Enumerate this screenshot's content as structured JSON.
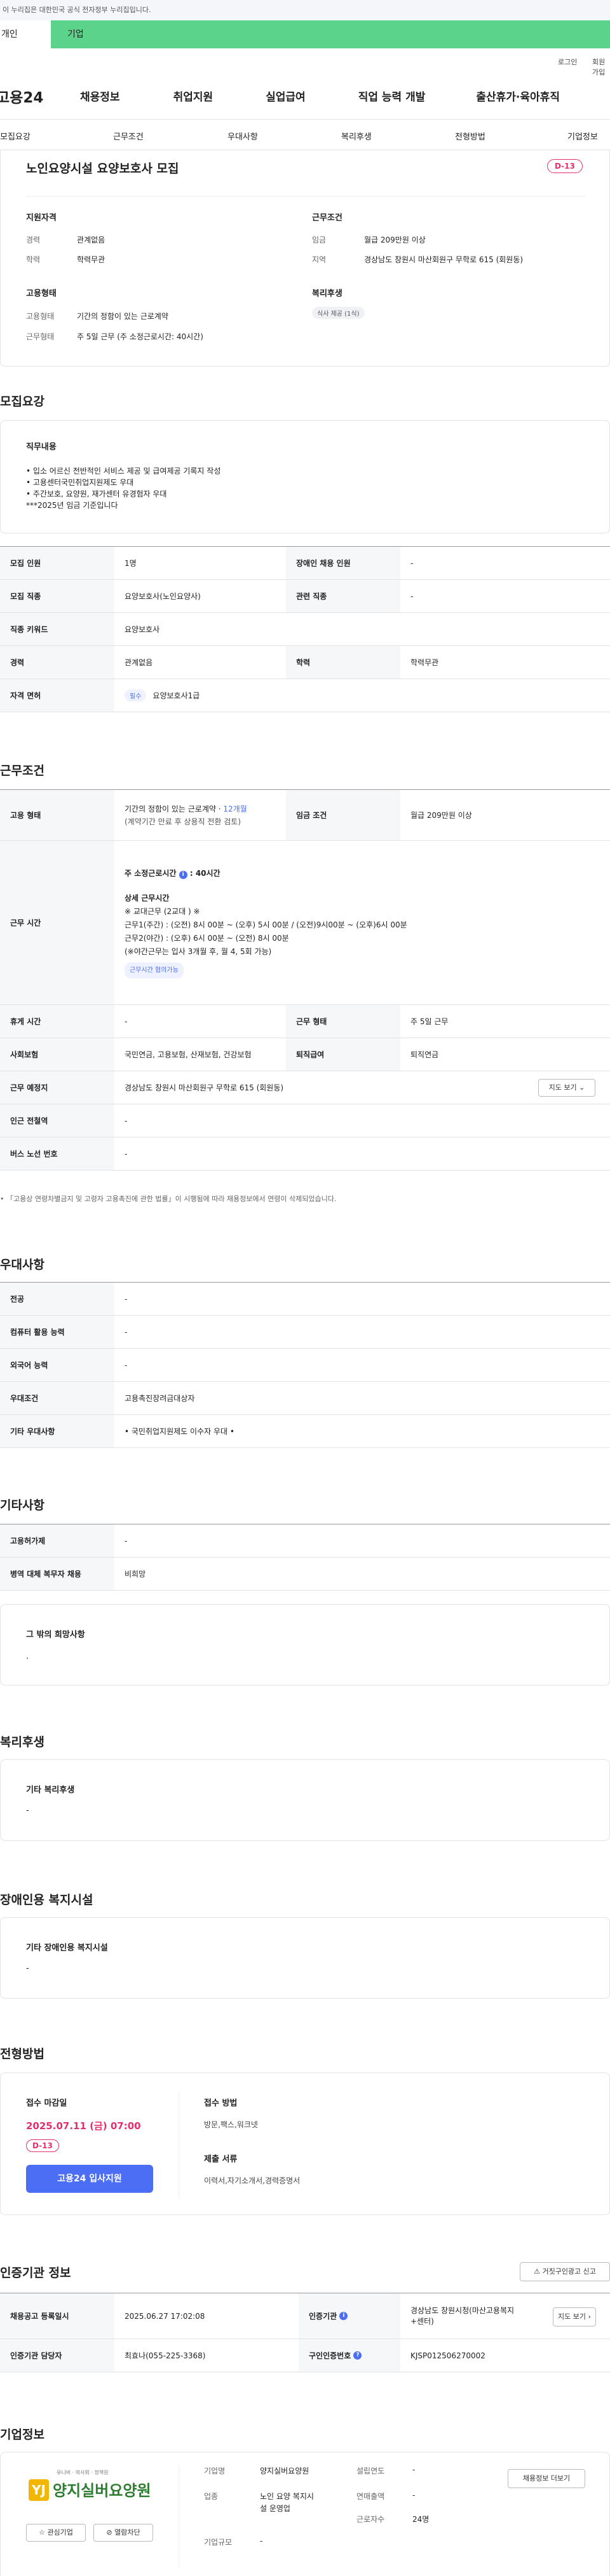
{
  "gov_notice": "이 누리집은 대한민국 공식 전자정부 누리집입니다.",
  "env_tabs": [
    "개인",
    "기업"
  ],
  "util": {
    "login": "로그인",
    "join": "회원가입"
  },
  "gnb": {
    "logo": "고용24",
    "menus": [
      "채용정보",
      "취업지원",
      "실업급여",
      "직업 능력 개발",
      "출산휴가·육아휴직"
    ]
  },
  "anchors": [
    "모집요강",
    "근무조건",
    "우대사항",
    "복리후생",
    "전형방법",
    "기업정보"
  ],
  "summary": {
    "title": "노인요양시설 요양보호사 모집",
    "dday": "D-13",
    "qual_title": "지원자격",
    "work_title": "근무조건",
    "career_label": "경력",
    "career": "관계없음",
    "edu_label": "학력",
    "edu": "학력무관",
    "wage_label": "임금",
    "wage": "월급 209만원 이상",
    "region_label": "지역",
    "region": "경상남도 창원시 마산회원구 무학로 615 (회원동)",
    "emp_title": "고용형태",
    "welfare_title": "복리후생",
    "emptype_label": "고용형태",
    "emptype": "기간의 정함이 있는 근로계약",
    "workform_label": "근무형태",
    "workform": "주 5일 근무 (주 소정근로시간: 40시간)",
    "welfare_badge": "식사 제공 (1식)"
  },
  "recruit": {
    "section": "모집요강",
    "duty_title": "직무내용",
    "duty_lines": [
      "• 입소 어르신 전반적인 서비스 제공 및 급여제공 기록지 작성",
      "• 고용센터국민취업지원제도 우대",
      "• 주간보호, 요양원, 재가센터 유경험자 우대",
      "***2025년 임금 기준입니다"
    ],
    "rows": [
      {
        "k1": "모집 인원",
        "v1": "1명",
        "k2": "장애인 채용 인원",
        "v2": "-"
      },
      {
        "k1": "모집 직종",
        "v1": "요양보호사(노인요양사)",
        "k2": "관련 직종",
        "v2": "-"
      },
      {
        "k1": "직종 키워드",
        "v1": "요양보호사"
      },
      {
        "k1": "경력",
        "v1": "관계없음",
        "k2": "학력",
        "v2": "학력무관"
      }
    ],
    "license_label": "자격 면허",
    "license_badge": "필수",
    "license": "요양보호사1급"
  },
  "cond": {
    "section": "근무조건",
    "emptype_label": "고용 형태",
    "emptype_line1": "기간의 정함이 있는 근로계약 ·",
    "emptype_months": "12개월",
    "emptype_line2": "(계약기간 만료 후 상용직 전환 검토)",
    "wage_label": "임금 조건",
    "wage": "월급 209만원 이상",
    "hours_label": "근무 시간",
    "hours_main": "주 소정근로시간",
    "hours_value": ": 40시간",
    "hours_detail_title": "상세 근무시간",
    "hours_lines": [
      "※ 교대근무 (2교대 ) ※",
      "근무1(주간) : (오전) 8시 00분 ~ (오후) 5시 00분 / (오전)9시00분 ~ (오후)6시 00분",
      "근무2(야간) : (오후) 6시 00분 ~ (오전) 8시 00분",
      "(※야간근무는 입사 3개월 후, 월 4, 5회 가능)"
    ],
    "hours_badge": "근무시간 협의가능",
    "rest_label": "휴게 시간",
    "rest": "-",
    "form_label": "근무 형태",
    "form": "주 5일 근무",
    "ins_label": "사회보험",
    "ins": "국민연금, 고용보험, 산재보험, 건강보험",
    "sev_label": "퇴직급여",
    "sev": "퇴직연금",
    "place_label": "근무 예정지",
    "place": "경상남도 창원시 마산회원구 무학로 615 (회원동)",
    "map_btn": "지도 보기",
    "subway_label": "인근 전철역",
    "subway": "-",
    "bus_label": "버스 노선 번호",
    "bus": "-",
    "footnote": "• 「고용상 연령차별금지 및 고령자 고용촉진에 관한 법률」이 시행됨에 따라 채용정보에서 연령이 삭제되었습니다."
  },
  "pref": {
    "section": "우대사항",
    "rows": [
      {
        "k": "전공",
        "v": "-"
      },
      {
        "k": "컴퓨터 활용 능력",
        "v": "-"
      },
      {
        "k": "외국어 능력",
        "v": "-"
      },
      {
        "k": "우대조건",
        "v": "고용촉진장려금대상자"
      },
      {
        "k": "기타 우대사항",
        "v": "• 국민취업지원제도 이수자 우대 •"
      }
    ]
  },
  "etc": {
    "section": "기타사항",
    "rows": [
      {
        "k": "고용허가제",
        "v": "-"
      },
      {
        "k": "병역 대체 복무자 채용",
        "v": "비희망"
      }
    ],
    "wish_title": "그 밖의 희망사항",
    "wish": "."
  },
  "welfare": {
    "section": "복리후생",
    "box_title": "기타 복리후생",
    "box_value": "-"
  },
  "disabled": {
    "section": "장애인용 복지시설",
    "box_title": "기타 장애인용 복지시설",
    "box_value": "-"
  },
  "process": {
    "section": "전형방법",
    "deadline_title": "접수 마감일",
    "deadline": "2025.07.11 (금) 07:00",
    "dday": "D-13",
    "apply_btn": "고용24 입사지원",
    "method_title": "접수 방법",
    "method": "방문,팩스,워크넷",
    "docs_title": "제출 서류",
    "docs": "이력서,자기소개서,경력증명서"
  },
  "cert": {
    "section": "인증기관 정보",
    "report_btn": "거짓구인광고 신고",
    "reg_label": "채용공고 등록일시",
    "reg": "2025.06.27 17:02:08",
    "org_label": "인증기관",
    "org": "경상남도 창원시청(마산고용복지+센터)",
    "org_btn": "지도 보기",
    "mgr_label": "인증기관 담당자",
    "mgr": "최효나(055-225-3368)",
    "id_label": "구인인증번호",
    "id": "KJSP012506270002"
  },
  "company": {
    "section": "기업정보",
    "logo_small": "유니버 · 의사회 · 정책원",
    "logo_text": "양지실버요양원",
    "fav_btn": "관심기업",
    "block_btn": "열람차단",
    "name_label": "기업명",
    "name": "양지실버요양원",
    "found_label": "설립연도",
    "found": "-",
    "ind_label": "업종",
    "ind1": "노인 요양 복지시",
    "ind2": "설 운영업",
    "sales_label": "연매출액",
    "sales": "-",
    "emp_label": "근로자수",
    "emp": "24명",
    "size_label": "기업규모",
    "size": "-",
    "jobs_btn": "채용정보 더보기"
  },
  "colors": {
    "accent": "#4c6ef5",
    "dday": "#e1306c",
    "env_tab": "#5bd38a"
  }
}
